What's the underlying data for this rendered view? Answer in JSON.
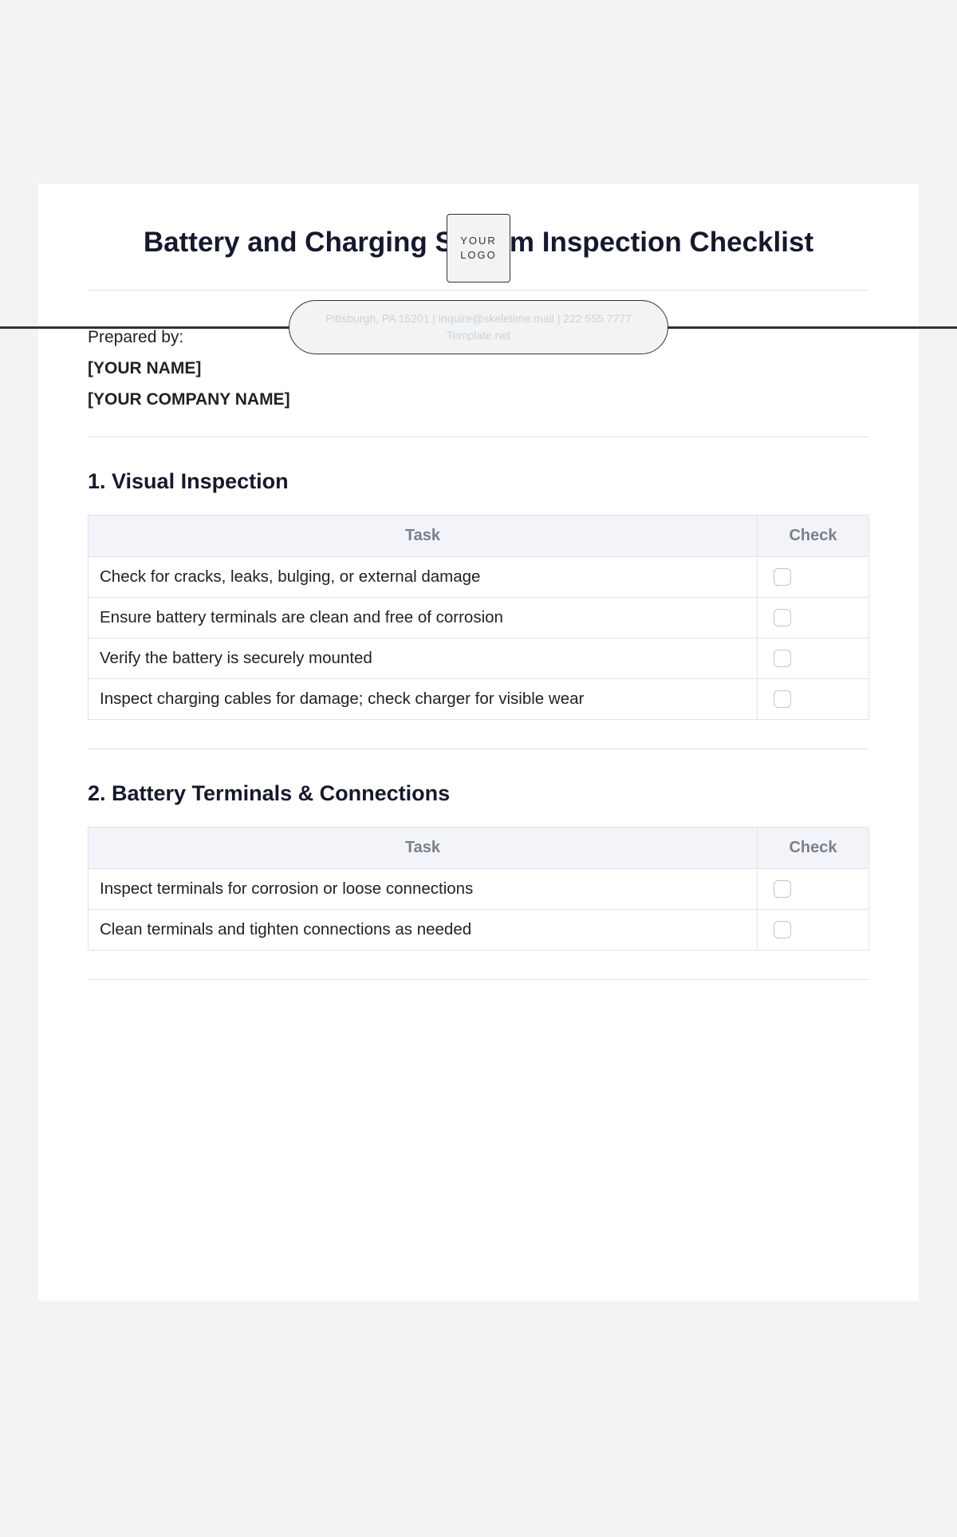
{
  "logo": {
    "line1": "YOUR",
    "line2": "LOGO"
  },
  "header": {
    "contact": "Pittsburgh, PA 15201 | inquire@skeletime.mail | 222 555 7777",
    "site": "Template.net"
  },
  "title": "Battery and Charging System Inspection Checklist",
  "prepared": {
    "label": "Prepared by:",
    "name": "[YOUR NAME]",
    "company": "[YOUR COMPANY NAME]"
  },
  "table_headers": {
    "task": "Task",
    "check": "Check"
  },
  "sections": [
    {
      "heading": "1. Visual Inspection",
      "rows": [
        "Check for cracks, leaks, bulging, or external damage",
        "Ensure battery terminals are clean and free of corrosion",
        "Verify the battery is securely mounted",
        "Inspect charging cables for damage; check charger for visible wear"
      ]
    },
    {
      "heading": "2. Battery Terminals & Connections",
      "rows": [
        "Inspect terminals for corrosion or loose connections",
        "Clean terminals and tighten connections as needed"
      ]
    }
  ]
}
